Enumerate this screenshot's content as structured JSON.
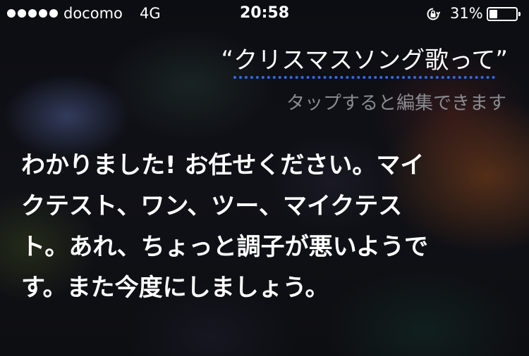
{
  "status_bar": {
    "signal_dots": 5,
    "carrier": "docomo",
    "network": "4G",
    "time": "20:58",
    "orientation_lock_icon": "orientation-lock-icon",
    "battery_percent": "31%",
    "battery_level": 0.31
  },
  "siri": {
    "open_quote": "“",
    "query": "クリスマスソング歌って",
    "close_quote": "”",
    "tap_hint": "タップすると編集できます",
    "response": "わかりました! お任せください。マイクテスト、ワン、ツー、マイクテスト。あれ、ちょっと調子が悪いようです。また今度にしましょう。"
  },
  "colors": {
    "underline": "#2f6cf0",
    "hint": "#8a8b90",
    "text": "#ffffff"
  }
}
